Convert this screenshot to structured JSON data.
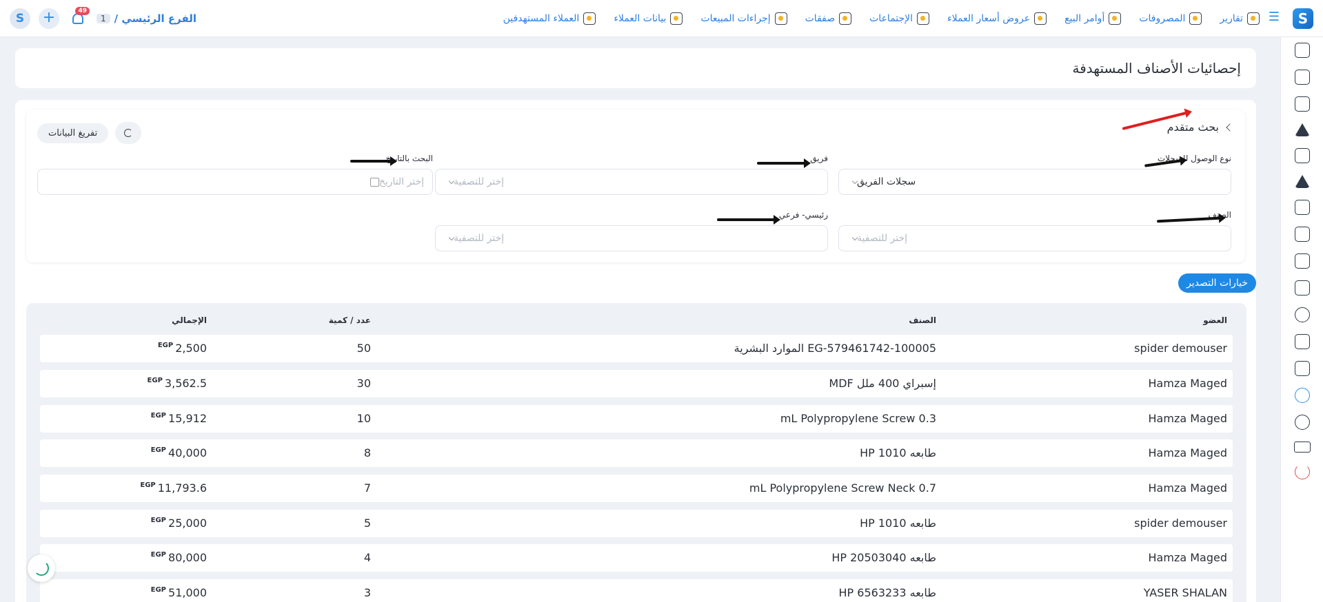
{
  "header": {
    "nav": [
      {
        "label": "العملاء المستهدفين",
        "icon": "target-customers-icon"
      },
      {
        "label": "بيانات العملاء",
        "icon": "customer-data-icon"
      },
      {
        "label": "إجراءات المبيعات",
        "icon": "sales-actions-icon"
      },
      {
        "label": "صفقات",
        "icon": "deals-icon"
      },
      {
        "label": "الإجتماعات",
        "icon": "meetings-icon"
      },
      {
        "label": "عروض أسعار العملاء",
        "icon": "quotes-icon"
      },
      {
        "label": "أوامر البيع",
        "icon": "sales-orders-icon"
      },
      {
        "label": "المصروفات",
        "icon": "expenses-icon"
      },
      {
        "label": "تقارير",
        "icon": "reports-icon"
      }
    ],
    "branch": {
      "label": "الفرع الرئيسي /",
      "number": "1"
    },
    "notifications_badge": "49",
    "brand_color": "#1e88e5"
  },
  "page": {
    "title": "إحصائيات الأصناف المستهدفة"
  },
  "filters": {
    "advanced_search_label": "بحث متقدم",
    "clear_label": "تفريغ البيانات",
    "access_type": {
      "label": "نوع الوصول للسجلات",
      "value": "سجلات الفريق"
    },
    "team": {
      "label": "فريق",
      "placeholder": "إختر للتصفية"
    },
    "date_search": {
      "label": "البحث بالتاريخ",
      "placeholder": "إختر التاريخ"
    },
    "category": {
      "label": "الصنف",
      "placeholder": "إختر للتصفية"
    },
    "main_sub": {
      "label": "رئيسي- فرعي",
      "placeholder": "إختر للتصفية"
    }
  },
  "export": {
    "label": "خيارات التصدير"
  },
  "table": {
    "headers": {
      "member": "العضو",
      "item": "الصنف",
      "qty": "عدد / كمية",
      "total": "الإجمالي"
    },
    "currency": "EGP",
    "rows": [
      {
        "member": "spider demouser",
        "item": "EG-579461742-100005 الموارد البشرية",
        "qty": "50",
        "total": "2,500"
      },
      {
        "member": "Hamza Maged",
        "item": "إسبراي 400 ملل MDF",
        "qty": "30",
        "total": "3,562.5"
      },
      {
        "member": "Hamza Maged",
        "item": "mL Polypropylene Screw 0.3",
        "qty": "10",
        "total": "15,912"
      },
      {
        "member": "Hamza Maged",
        "item": "طابعه HP 1010",
        "qty": "8",
        "total": "40,000"
      },
      {
        "member": "Hamza Maged",
        "item": "mL Polypropylene Screw Neck 0.7",
        "qty": "7",
        "total": "11,793.6"
      },
      {
        "member": "spider demouser",
        "item": "طابعه HP 1010",
        "qty": "5",
        "total": "25,000"
      },
      {
        "member": "Hamza Maged",
        "item": "طابعه HP 20503040",
        "qty": "4",
        "total": "80,000"
      },
      {
        "member": "YASER SHALAN",
        "item": "طابعه HP 6563233",
        "qty": "3",
        "total": "51,000"
      }
    ]
  }
}
